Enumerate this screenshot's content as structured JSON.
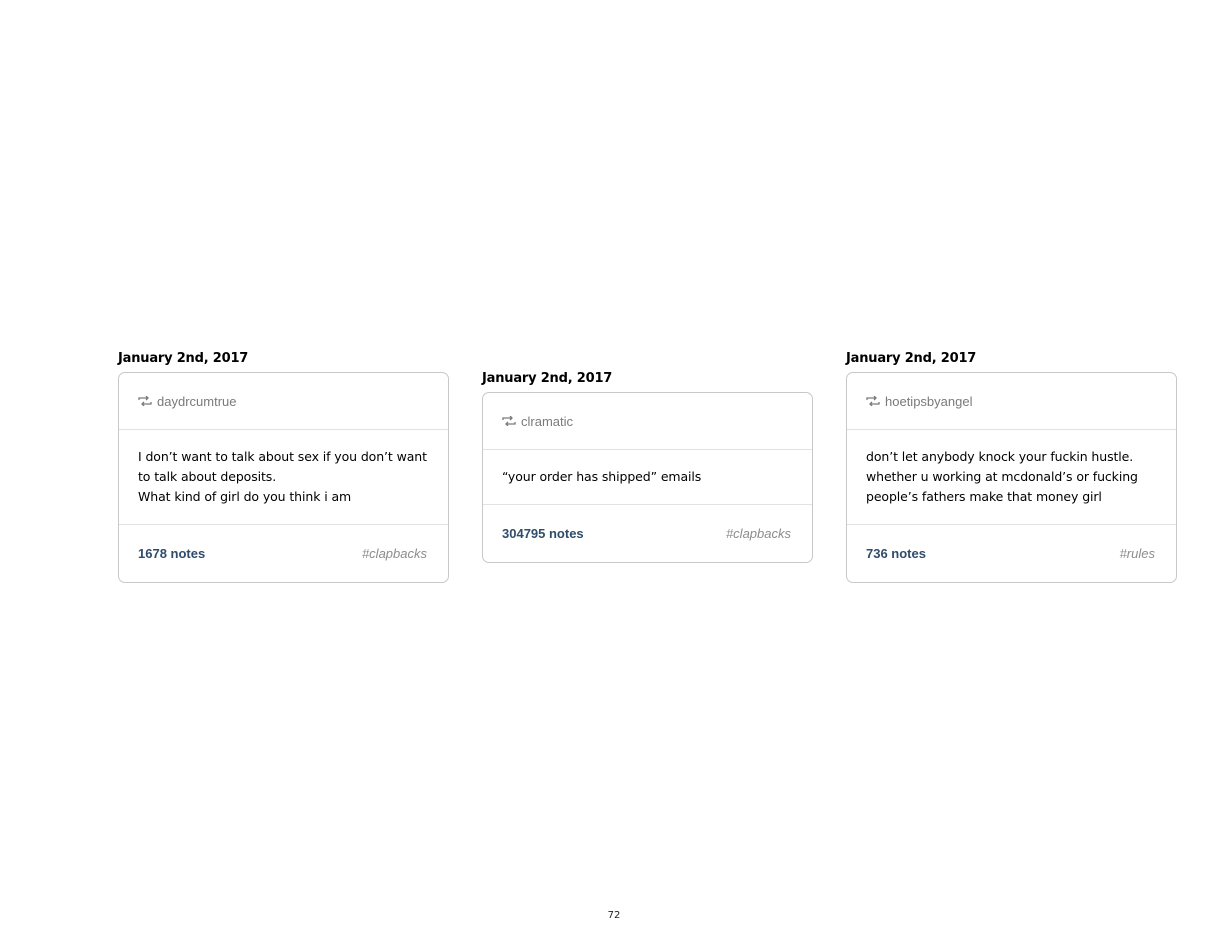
{
  "posts": [
    {
      "date": "January 2nd, 2017",
      "username": "daydrcumtrue",
      "icon": "reblog-icon",
      "text_lines": [
        "I don’t want to talk about sex if you don’t want",
        "to talk about deposits.",
        "What kind of girl do you think i am"
      ],
      "notes": "1678 notes",
      "tag": "#clapbacks"
    },
    {
      "date": "January 2nd, 2017",
      "username": "clramatic",
      "icon": "reblog-icon",
      "text_lines": [
        "“your order has shipped” emails"
      ],
      "notes": "304795 notes",
      "tag": "#clapbacks"
    },
    {
      "date": "January 2nd, 2017",
      "username": "hoetipsbyangel",
      "icon": "reblog-icon",
      "text_lines": [
        "don’t let anybody knock your fuckin hustle.",
        "whether u working at mcdonald’s or fucking",
        "people’s fathers make that money girl"
      ],
      "notes": "736 notes",
      "tag": "#rules"
    }
  ],
  "page_number": "72",
  "colors": {
    "notes": "#2f4d6a",
    "tag": "#8c8c8c",
    "username": "#7a7a7a",
    "border": "#c8c8c8"
  }
}
